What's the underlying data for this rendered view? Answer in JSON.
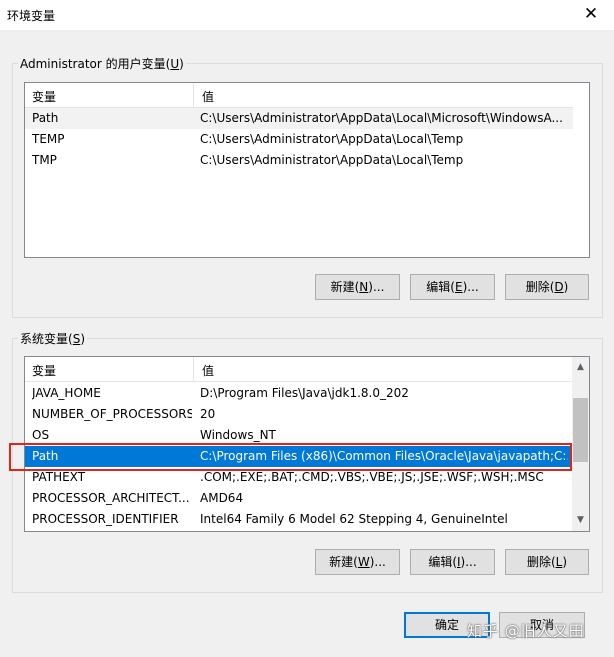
{
  "window": {
    "title": "环境变量",
    "close_glyph": "✕"
  },
  "user_vars": {
    "group_label_prefix": "Administrator 的用户变量(",
    "group_label_key": "U",
    "group_label_suffix": ")",
    "columns": [
      "变量",
      "值"
    ],
    "rows": [
      {
        "name": "Path",
        "value": "C:\\Users\\Administrator\\AppData\\Local\\Microsoft\\WindowsA..."
      },
      {
        "name": "TEMP",
        "value": "C:\\Users\\Administrator\\AppData\\Local\\Temp"
      },
      {
        "name": "TMP",
        "value": "C:\\Users\\Administrator\\AppData\\Local\\Temp"
      }
    ],
    "buttons": {
      "new": {
        "pre": "新建(",
        "key": "N",
        "post": ")..."
      },
      "edit": {
        "pre": "编辑(",
        "key": "E",
        "post": ")..."
      },
      "delete": {
        "pre": "删除(",
        "key": "D",
        "post": ")"
      }
    }
  },
  "system_vars": {
    "group_label_prefix": "系统变量(",
    "group_label_key": "S",
    "group_label_suffix": ")",
    "columns": [
      "变量",
      "值"
    ],
    "rows": [
      {
        "name": "JAVA_HOME",
        "value": "D:\\Program Files\\Java\\jdk1.8.0_202"
      },
      {
        "name": "NUMBER_OF_PROCESSORS",
        "value": "20"
      },
      {
        "name": "OS",
        "value": "Windows_NT"
      },
      {
        "name": "Path",
        "value": "C:\\Program Files (x86)\\Common Files\\Oracle\\Java\\javapath;C:..."
      },
      {
        "name": "PATHEXT",
        "value": ".COM;.EXE;.BAT;.CMD;.VBS;.VBE;.JS;.JSE;.WSF;.WSH;.MSC"
      },
      {
        "name": "PROCESSOR_ARCHITECT...",
        "value": "AMD64"
      },
      {
        "name": "PROCESSOR_IDENTIFIER",
        "value": "Intel64 Family 6 Model 62 Stepping 4, GenuineIntel"
      }
    ],
    "selected_index": 3,
    "buttons": {
      "new": {
        "pre": "新建(",
        "key": "W",
        "post": ")..."
      },
      "edit": {
        "pre": "编辑(",
        "key": "I",
        "post": ")..."
      },
      "delete": {
        "pre": "删除(",
        "key": "L",
        "post": ")"
      }
    },
    "scroll_up_glyph": "▲",
    "scroll_down_glyph": "▼"
  },
  "footer": {
    "ok_label": "确定",
    "cancel_label": "取消"
  },
  "watermark": "知乎 @旧人又田",
  "colors": {
    "selection": "#0078d7",
    "highlight_box": "#e1251b"
  }
}
